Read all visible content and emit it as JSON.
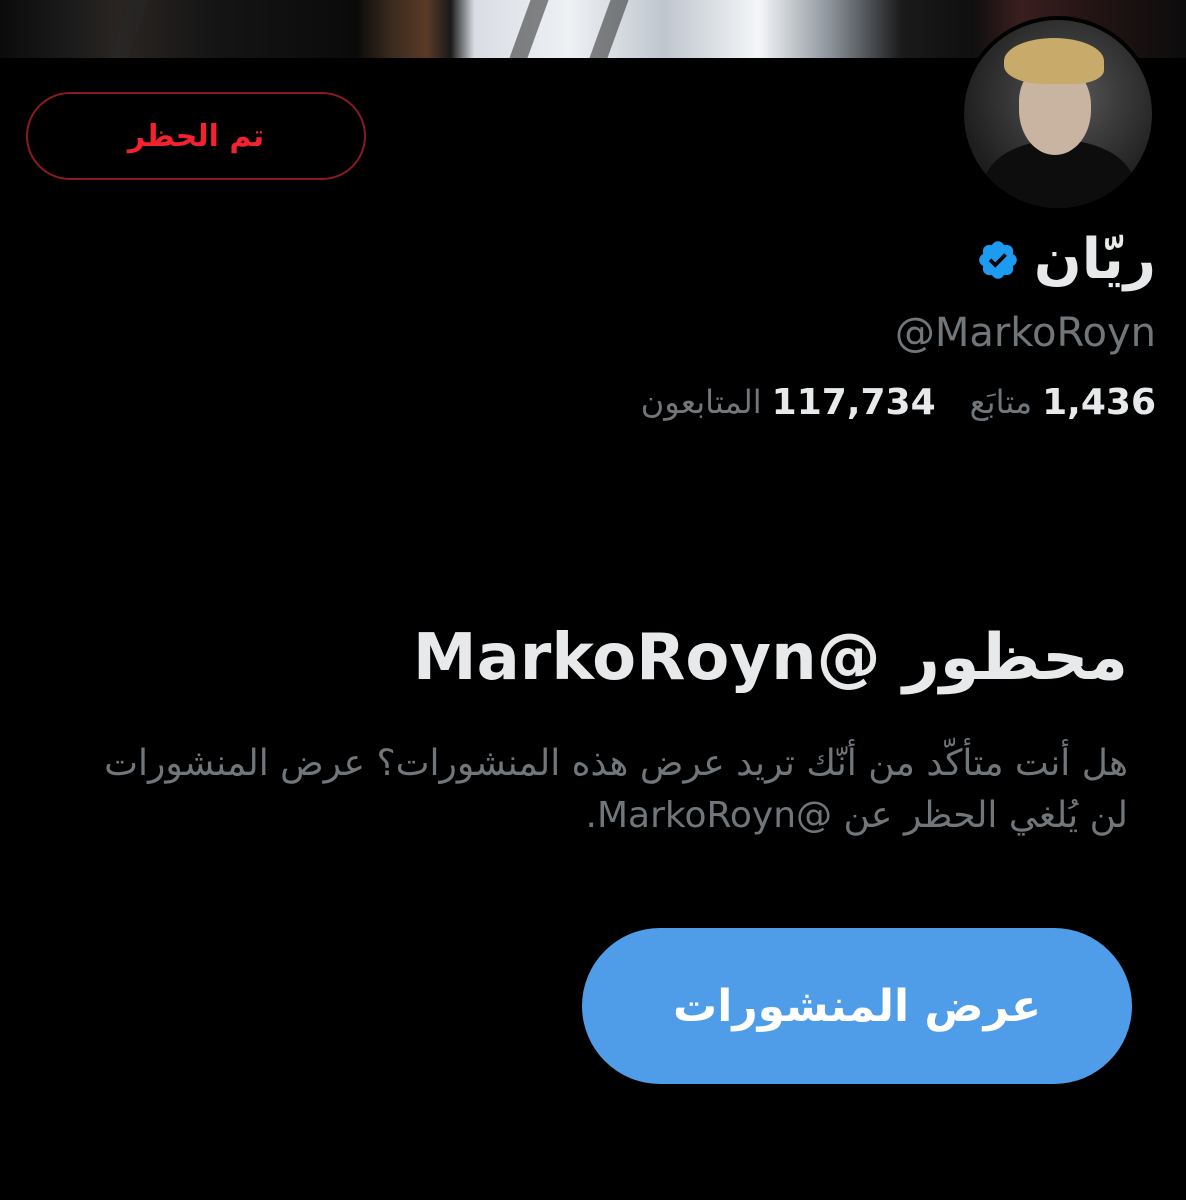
{
  "profile": {
    "display_name": "ريّان",
    "handle": "@MarkoRoyn",
    "verified_icon": "verified-badge-icon",
    "following_count": "1,436",
    "following_label": "متابَع",
    "followers_count": "117,734",
    "followers_label": "المتابعون"
  },
  "actions": {
    "blocked_label": "تم الحظر",
    "view_posts_label": "عرض المنشورات"
  },
  "blocked_notice": {
    "title": "محظور @MarkoRoyn",
    "description": "هل أنت متأكّد من أنّك تريد عرض هذه المنشورات؟ عرض المنشورات لن يُلغي الحظر عن @MarkoRoyn."
  },
  "colors": {
    "background": "#000000",
    "accent": "#4f9de8",
    "danger": "#f4212e",
    "verified": "#1d9bf0",
    "muted_text": "#71767b"
  }
}
